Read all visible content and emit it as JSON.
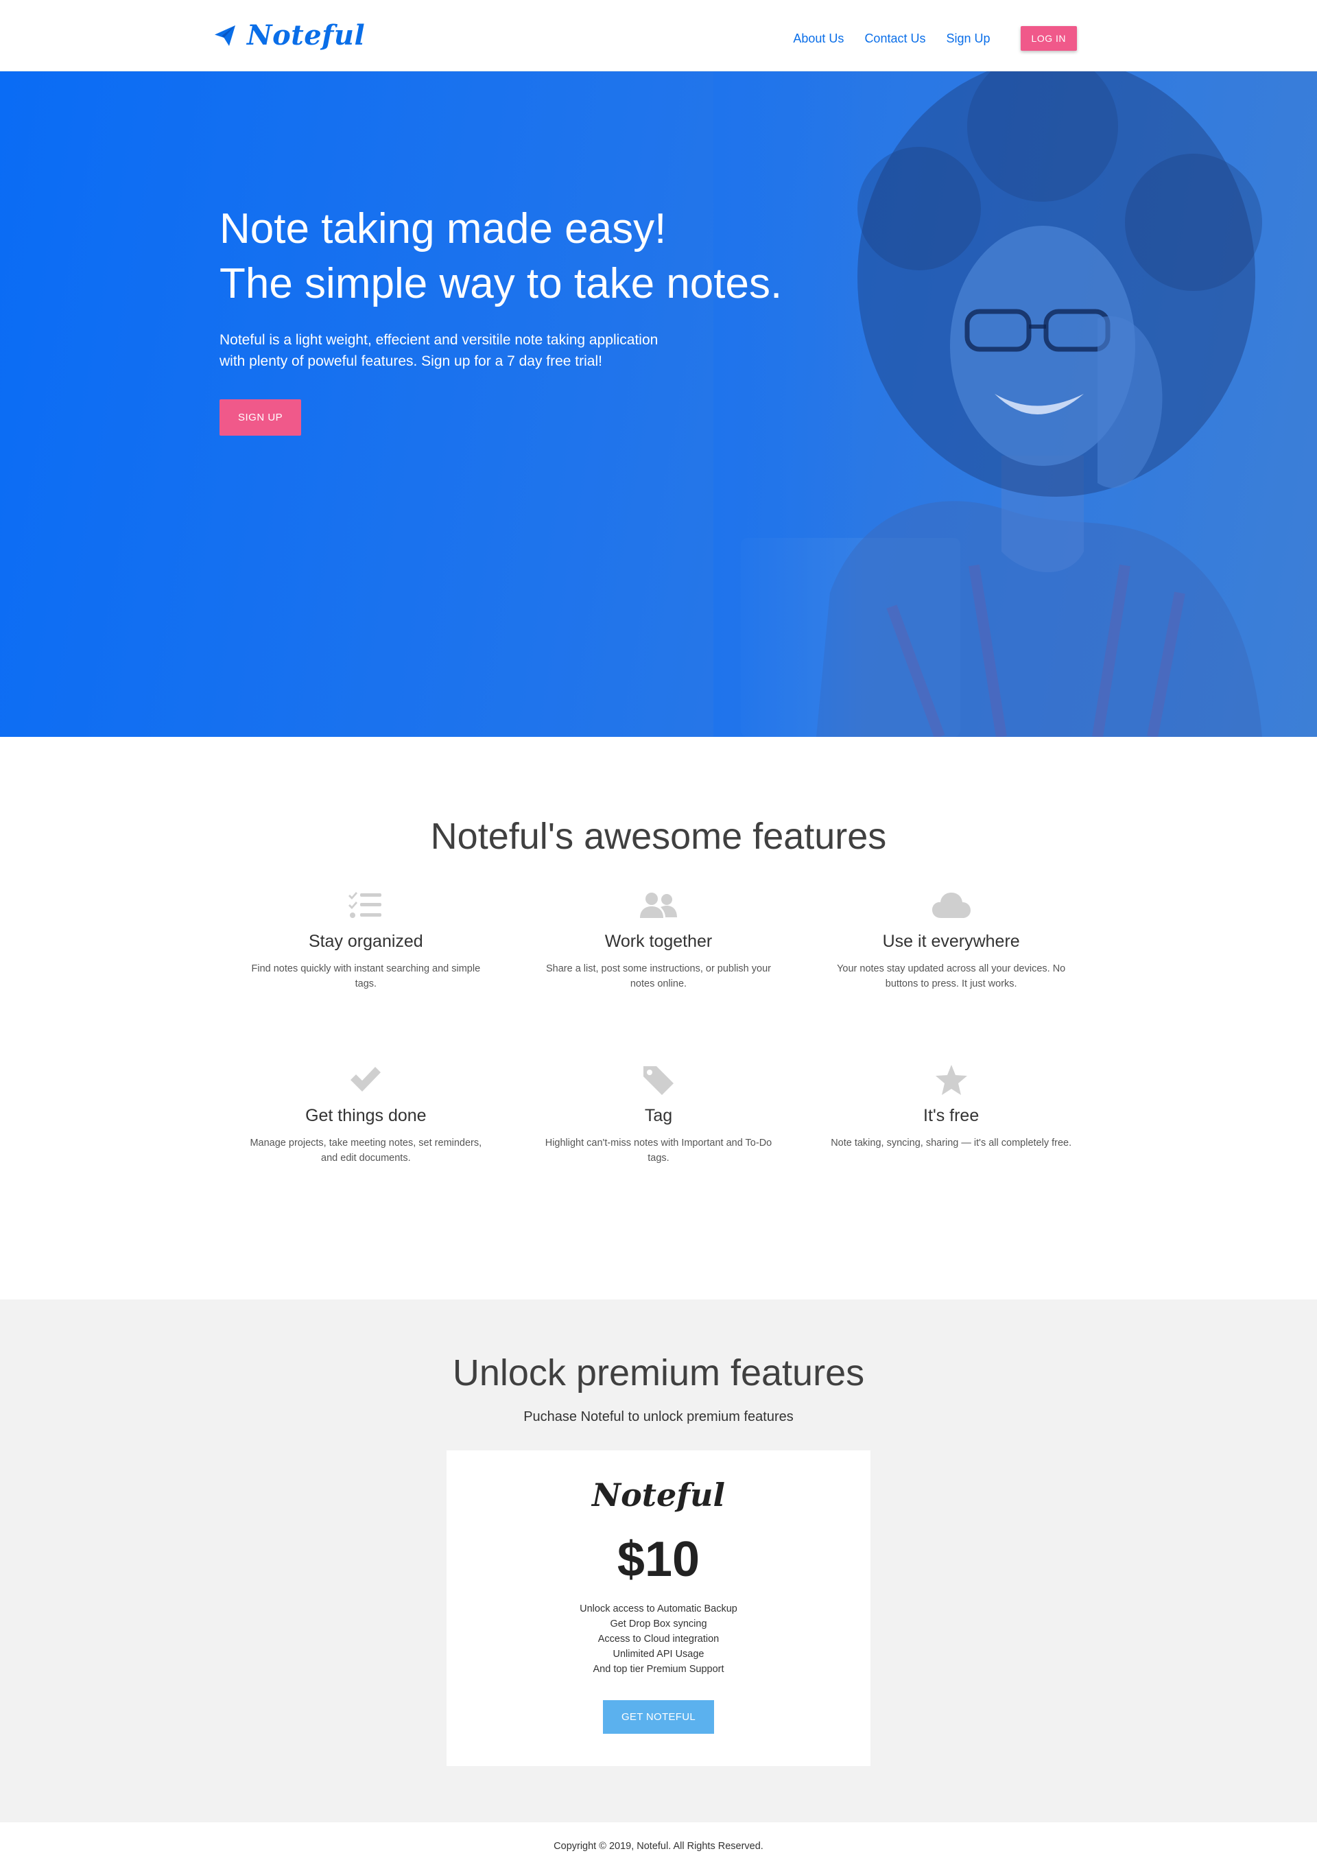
{
  "nav": {
    "brand": "Noteful",
    "links": [
      "About Us",
      "Contact Us",
      "Sign Up"
    ],
    "login_label": "LOG IN"
  },
  "hero": {
    "title_line1": "Note taking made easy!",
    "title_line2": "The simple way to take notes.",
    "subtitle": "Noteful is a light weight, effecient and versitile note taking application with plenty of poweful features. Sign up for a 7 day free trial!",
    "cta_label": "SIGN UP"
  },
  "features": {
    "title": "Noteful's awesome features",
    "items": [
      {
        "icon": "checklist-icon",
        "title": "Stay organized",
        "desc": "Find notes quickly with instant searching and simple tags."
      },
      {
        "icon": "users-icon",
        "title": "Work together",
        "desc": "Share a list, post some instructions, or publish your notes online."
      },
      {
        "icon": "cloud-icon",
        "title": "Use it everywhere",
        "desc": "Your notes stay updated across all your devices. No buttons to press. It just works."
      },
      {
        "icon": "check-icon",
        "title": "Get things done",
        "desc": "Manage projects, take meeting notes, set reminders, and edit documents."
      },
      {
        "icon": "tag-icon",
        "title": "Tag",
        "desc": "Highlight can't-miss notes with Important and To-Do tags."
      },
      {
        "icon": "star-icon",
        "title": "It's free",
        "desc": "Note taking, syncing, sharing — it's all completely free."
      }
    ]
  },
  "premium": {
    "title": "Unlock premium features",
    "subtitle": "Puchase Noteful to unlock premium features",
    "card": {
      "logo": "Noteful",
      "price": "$10",
      "perks": [
        "Unlock access to Automatic Backup",
        "Get Drop Box syncing",
        "Access to Cloud integration",
        "Unlimited API Usage",
        "And top tier Premium Support"
      ],
      "cta_label": "GET NOTEFUL"
    }
  },
  "footer": {
    "copyright": "Copyright © 2019, Noteful. All Rights Reserved."
  },
  "colors": {
    "brand_blue": "#0a6ee8",
    "accent_pink": "#f0598a",
    "cta_light_blue": "#5bb1ee",
    "icon_gray": "#cfcfcf"
  }
}
